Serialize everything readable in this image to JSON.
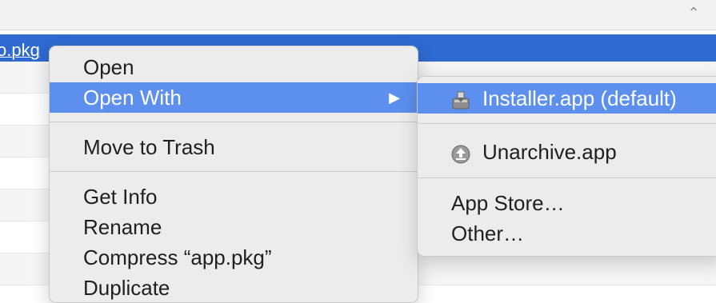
{
  "finder": {
    "selected_file": "o.pkg",
    "chevron_glyph": "⌃"
  },
  "context_menu": {
    "items": [
      {
        "label": "Open"
      },
      {
        "label": "Open With",
        "submenu_arrow": "▶"
      },
      {
        "label": "Move to Trash"
      },
      {
        "label": "Get Info"
      },
      {
        "label": "Rename"
      },
      {
        "label": "Compress “app.pkg”"
      },
      {
        "label": "Duplicate"
      }
    ]
  },
  "open_with_submenu": {
    "items": [
      {
        "label": "Installer.app (default)",
        "icon": "installer-icon"
      },
      {
        "label": "Unarchive.app",
        "icon": "unarchive-icon"
      },
      {
        "label": "App Store…"
      },
      {
        "label": "Other…"
      }
    ]
  },
  "colors": {
    "selection": "#2f6ad1",
    "menu_highlight": "#5c8fee",
    "menu_background": "#ececec"
  }
}
